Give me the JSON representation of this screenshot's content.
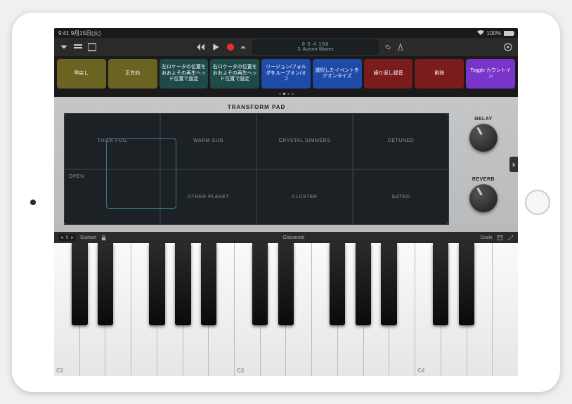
{
  "status": {
    "time": "9:41",
    "date": "9月15日(火)",
    "battery": "100%"
  },
  "toolbar": {
    "lcd_line1": "8 5 4 198",
    "lcd_line2": "3: Aurora Waves"
  },
  "key_commands": [
    {
      "label": "早戻し",
      "color": "olive"
    },
    {
      "label": "正方向",
      "color": "olive"
    },
    {
      "label": "左ロケータの位置をおおよその再生ヘッド位置で設定",
      "color": "teal"
    },
    {
      "label": "右ロケータの位置をおおよその再生ヘッド位置で設定",
      "color": "teal"
    },
    {
      "label": "リージョン/フォルダをループオン/オフ",
      "color": "blue"
    },
    {
      "label": "選択したイベントをクオンタイズ",
      "color": "blue"
    },
    {
      "label": "繰り返し録音",
      "color": "red"
    },
    {
      "label": "削除",
      "color": "red"
    },
    {
      "label": "Toggle カウントイン",
      "color": "purple"
    }
  ],
  "synth": {
    "pad_title": "TRANSFORM PAD",
    "cells": [
      "THICK FOG",
      "WARM SUN",
      "CRYSTAL SIMMERS",
      "DETUNED",
      "OPEN",
      "OTHER PLANET",
      "CLUSTER",
      "GATED"
    ],
    "knob1_label": "DELAY",
    "knob2_label": "REVERB"
  },
  "kb_strip": {
    "octave": "0",
    "sustain": "Sustain",
    "mode": "Glissando",
    "scale": "Scale"
  },
  "piano": {
    "labels": {
      "c2": "C2",
      "c3": "C3",
      "c4": "C4"
    }
  }
}
